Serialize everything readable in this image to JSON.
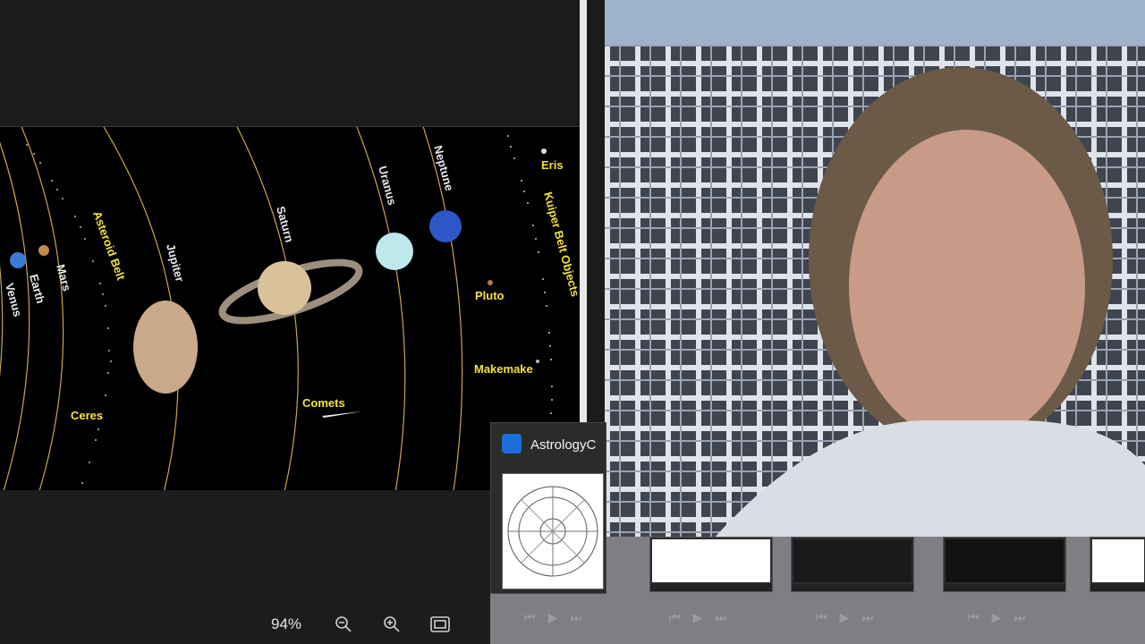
{
  "diagram": {
    "planets": [
      "Venus",
      "Earth",
      "Mars",
      "Jupiter",
      "Saturn",
      "Uranus",
      "Neptune"
    ],
    "objects": [
      "Asteroid Belt",
      "Ceres",
      "Comets",
      "Pluto",
      "Makemake",
      "Eris",
      "Kuiper Belt Objects"
    ]
  },
  "toolbar": {
    "zoom": "94%",
    "zoom_out_icon": "zoom-out-icon",
    "zoom_in_icon": "zoom-in-icon",
    "fit_icon": "fit-page-icon"
  },
  "popup": {
    "title": "AstrologyC"
  },
  "colors": {
    "label_yellow": "#f3e23a",
    "space_black": "#000000",
    "viewer_bg": "#1c1c1c"
  }
}
